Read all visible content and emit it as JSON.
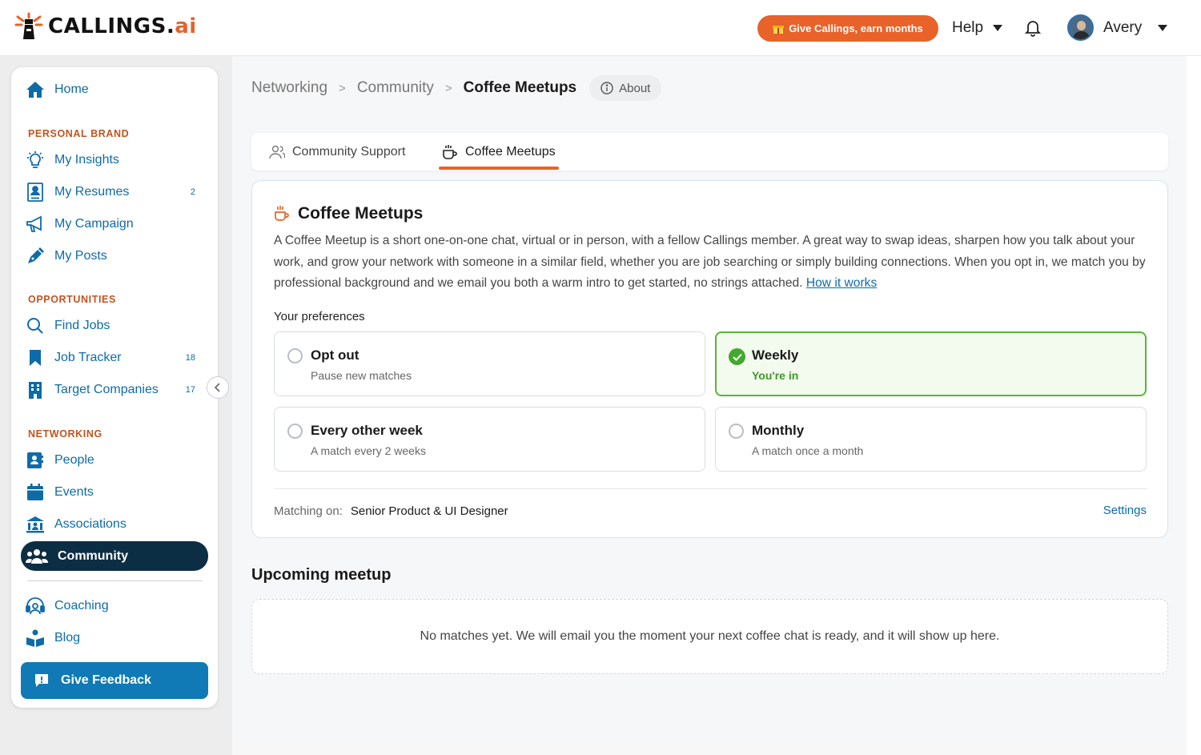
{
  "header": {
    "logo_main": "CALLINGS.",
    "logo_ai": "ai",
    "promo_label": "Give Callings, earn months",
    "help_label": "Help",
    "user_name": "Avery"
  },
  "sidebar": {
    "home": "Home",
    "sections": {
      "personal_brand": "PERSONAL BRAND",
      "opportunities": "OPPORTUNITIES",
      "networking": "NETWORKING"
    },
    "items": {
      "my_insights": "My Insights",
      "my_resumes": "My Resumes",
      "my_resumes_count": "2",
      "my_campaign": "My Campaign",
      "my_posts": "My Posts",
      "find_jobs": "Find Jobs",
      "job_tracker": "Job Tracker",
      "job_tracker_count": "18",
      "target_companies": "Target Companies",
      "target_companies_count": "17",
      "people": "People",
      "events": "Events",
      "associations": "Associations",
      "community": "Community",
      "coaching": "Coaching",
      "blog": "Blog"
    },
    "feedback": "Give Feedback"
  },
  "breadcrumb": {
    "level1": "Networking",
    "level2": "Community",
    "current": "Coffee Meetups",
    "about": "About"
  },
  "tabs": [
    {
      "label": "Community Support",
      "active": false
    },
    {
      "label": "Coffee Meetups",
      "active": true
    }
  ],
  "card": {
    "title": "Coffee Meetups",
    "description": "A Coffee Meetup is a short one-on-one chat, virtual or in person, with a fellow Callings member. A great way to swap ideas, sharpen how you talk about your work, and grow your network with someone in a similar field, whether you are job searching or simply building connections. When you opt in, we match you by professional background and we email you both a warm intro to get started, no strings attached.",
    "how_link": "How it works",
    "preferences_label": "Your preferences",
    "options": [
      {
        "title": "Opt out",
        "subtitle": "Pause new matches",
        "selected": false
      },
      {
        "title": "Weekly",
        "subtitle": "You're in",
        "selected": true
      },
      {
        "title": "Every other week",
        "subtitle": "A match every 2 weeks",
        "selected": false
      },
      {
        "title": "Monthly",
        "subtitle": "A match once a month",
        "selected": false
      }
    ],
    "matching_label": "Matching on:",
    "matching_value": "Senior Product & UI Designer",
    "settings_label": "Settings"
  },
  "upcoming": {
    "title": "Upcoming meetup",
    "empty_text": "No matches yet. We will email you the moment your next coffee chat is ready, and it will show up here."
  },
  "colors": {
    "brand_orange": "#e8622a",
    "nav_blue": "#0e6ba8",
    "active_nav": "#0c2e45",
    "selected_green": "#43a82e"
  }
}
